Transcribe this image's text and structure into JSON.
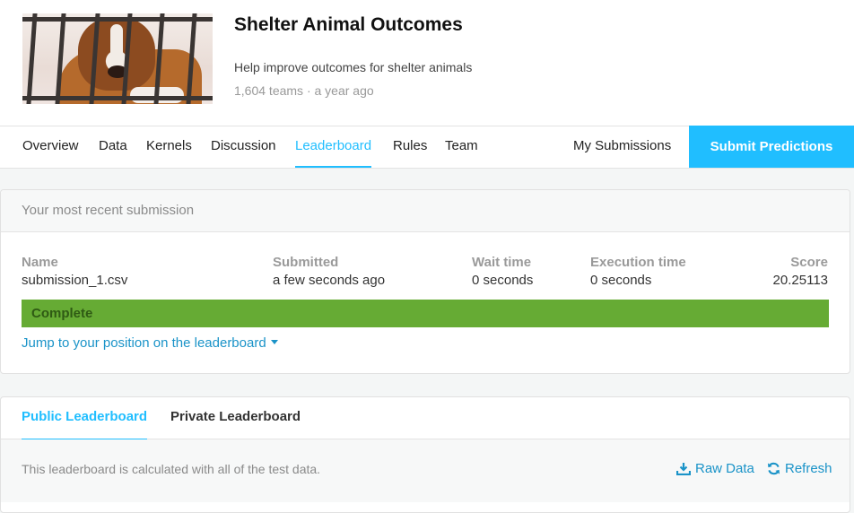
{
  "competition": {
    "title": "Shelter Animal Outcomes",
    "subtitle": "Help improve outcomes for shelter animals",
    "meta": "1,604 teams · a year ago"
  },
  "tabs": {
    "items": [
      "Overview",
      "Data",
      "Kernels",
      "Discussion",
      "Leaderboard",
      "Rules",
      "Team"
    ],
    "active": "Leaderboard",
    "my_submissions": "My Submissions",
    "submit": "Submit Predictions"
  },
  "submission": {
    "heading": "Your most recent submission",
    "columns": {
      "name": {
        "label": "Name",
        "value": "submission_1.csv"
      },
      "submitted": {
        "label": "Submitted",
        "value": "a few seconds ago"
      },
      "wait": {
        "label": "Wait time",
        "value": "0 seconds"
      },
      "execution": {
        "label": "Execution time",
        "value": "0 seconds"
      },
      "score": {
        "label": "Score",
        "value": "20.25113"
      }
    },
    "status": "Complete",
    "jump_link": "Jump to your position on the leaderboard"
  },
  "leaderboard": {
    "tabs": [
      "Public Leaderboard",
      "Private Leaderboard"
    ],
    "active": "Public Leaderboard",
    "note": "This leaderboard is calculated with all of the test data.",
    "raw_data": "Raw Data",
    "refresh": "Refresh"
  },
  "colors": {
    "accent": "#20beff",
    "link": "#1a93c8",
    "status_complete": "#66ab34"
  },
  "icons": {
    "raw_data": "download-icon",
    "refresh": "refresh-icon",
    "jump": "caret-down-icon"
  }
}
